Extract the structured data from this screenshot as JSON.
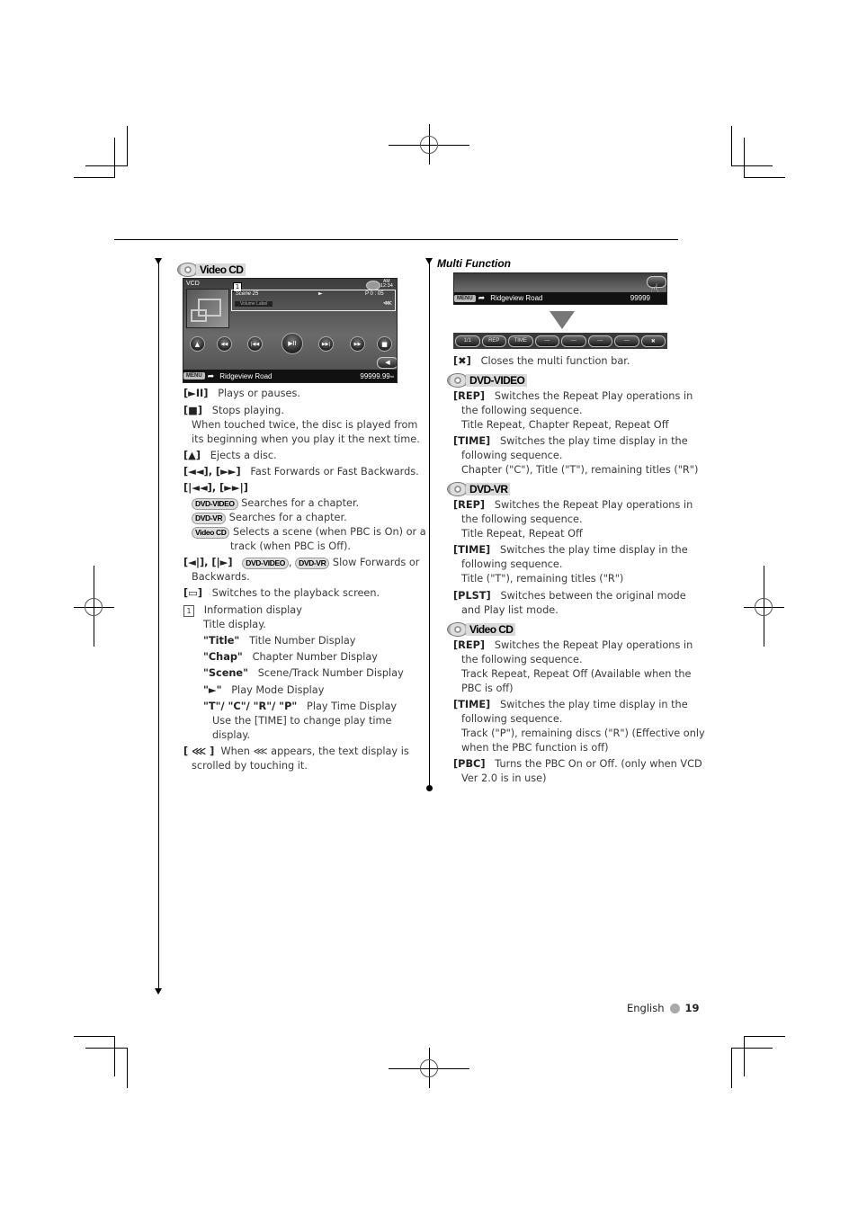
{
  "page": {
    "language": "English",
    "page_number": "19"
  },
  "left": {
    "section_title": "Video CD",
    "screen": {
      "source": "VCD",
      "clock_ampm": "AM",
      "clock_time": "12:34",
      "info_marker": "1",
      "scene": "Scene 25",
      "play_mode": "►",
      "play_time": "P 0 : 05",
      "volume_label": "Volume Label",
      "scroll_glyph": "⋘",
      "buttons": [
        "▲",
        "◀◀",
        "|◀◀",
        "▶II",
        "▶▶|",
        "▶▶",
        "■"
      ],
      "back_glyph": "◀",
      "menu_label": "MENU",
      "road": "Ridgeview Road",
      "distance": "99999.99",
      "distance_unit": "mi"
    },
    "items": [
      {
        "key": "[►II]",
        "text": "Plays or pauses."
      },
      {
        "key": "[■]",
        "text": "Stops playing."
      },
      {
        "text": "When touched twice, the disc is played from"
      },
      {
        "text": "its beginning when you play it the next time."
      },
      {
        "key": "[▲]",
        "text": "Ejects a disc."
      },
      {
        "key": "[◄◄], [►►]",
        "text": "Fast Forwards or Fast Backwards."
      },
      {
        "key": "[|◄◄], [►►|]"
      },
      {
        "badge": "DVD-VIDEO",
        "text": "Searches for a chapter."
      },
      {
        "badge": "DVD-VR",
        "text": "Searches for a chapter."
      },
      {
        "badge": "Video CD",
        "text": "Selects a scene (when PBC is On) or a"
      },
      {
        "text": "track (when PBC is Off)."
      },
      {
        "key": "[◄|], [|►]",
        "badge1": "DVD-VIDEO",
        "badge2": "DVD-VR",
        "text": "Slow Forwards or"
      },
      {
        "text": "Backwards."
      },
      {
        "key": "[▭]",
        "text": "Switches to the playback screen."
      },
      {
        "key": "1",
        "text": "Information display"
      },
      {
        "text": "Title display."
      },
      {
        "key": "\"Title\"",
        "text": "Title Number Display"
      },
      {
        "key": "\"Chap\"",
        "text": "Chapter Number Display"
      },
      {
        "key": "\"Scene\"",
        "text": "Scene/Track Number Display"
      },
      {
        "key": "\"►\"",
        "text": "Play Mode Display"
      },
      {
        "key": "\"T\"/ \"C\"/ \"R\"/ \"P\"",
        "text": "Play Time Display"
      },
      {
        "text": "Use the [TIME] to change play time"
      },
      {
        "text": "display."
      },
      {
        "key": "[ ⋘ ]",
        "text": "When  ⋘  appears, the text display is"
      },
      {
        "text": "scrolled by touching it."
      }
    ]
  },
  "right": {
    "section_title": "Multi Function",
    "screen": {
      "menu_label": "MENU",
      "road": "Ridgeview Road",
      "distance": "99999",
      "mf_buttons": [
        "1/1",
        "REP",
        "TIME",
        "—",
        "—",
        "—",
        "—",
        "✖"
      ]
    },
    "close_key": "[✖]",
    "close_text": "Closes the multi function bar.",
    "groups": [
      {
        "title": "DVD-VIDEO",
        "items": [
          {
            "key": "[REP]",
            "text": "Switches the Repeat Play operations in"
          },
          {
            "text": "the following sequence."
          },
          {
            "text": "Title Repeat, Chapter Repeat, Repeat Off"
          },
          {
            "key": "[TIME]",
            "text": "Switches the play time display in the"
          },
          {
            "text": "following sequence."
          },
          {
            "text": "Chapter (\"C\"), Title (\"T\"), remaining titles (\"R\")"
          }
        ]
      },
      {
        "title": "DVD-VR",
        "items": [
          {
            "key": "[REP]",
            "text": "Switches the Repeat Play operations in"
          },
          {
            "text": "the following sequence."
          },
          {
            "text": "Title Repeat, Repeat Off"
          },
          {
            "key": "[TIME]",
            "text": "Switches the play time display in the"
          },
          {
            "text": "following sequence."
          },
          {
            "text": "Title (\"T\"), remaining titles (\"R\")"
          },
          {
            "key": "[PLST]",
            "text": "Switches between the original mode"
          },
          {
            "text": "and Play list mode."
          }
        ]
      },
      {
        "title": "Video CD",
        "items": [
          {
            "key": "[REP]",
            "text": "Switches the Repeat Play operations in"
          },
          {
            "text": "the following sequence."
          },
          {
            "text": "Track Repeat, Repeat Off (Available when the"
          },
          {
            "text": "PBC is off)"
          },
          {
            "key": "[TIME]",
            "text": "Switches the play time display in the"
          },
          {
            "text": "following sequence."
          },
          {
            "text": "Track (\"P\"), remaining discs (\"R\") (Effective only"
          },
          {
            "text": "when the PBC function is off)"
          },
          {
            "key": "[PBC]",
            "text": "Turns the PBC On or Off. (only when VCD"
          },
          {
            "text": "Ver 2.0 is in use)"
          }
        ]
      }
    ]
  }
}
